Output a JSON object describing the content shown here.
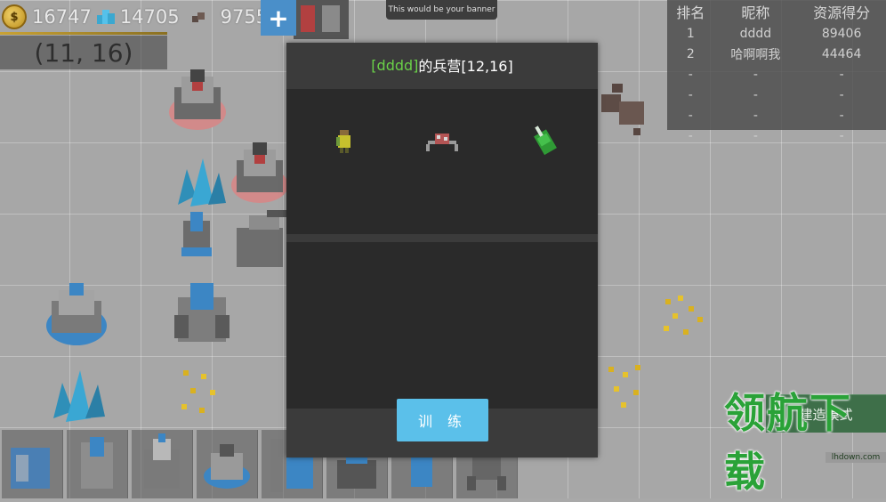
{
  "resources": {
    "gold": "16747",
    "crystal": "14705",
    "ore": "9755",
    "gold_icon_letter": "$"
  },
  "coordinate_display": "(11, 16)",
  "plus_button_label": "+",
  "banner_text": "This would be your banner",
  "ranking": {
    "headers": [
      "排名",
      "昵称",
      "资源得分"
    ],
    "rows": [
      [
        "1",
        "dddd",
        "89406"
      ],
      [
        "2",
        "哈啊啊我",
        "44464"
      ],
      [
        "-",
        "-",
        "-"
      ],
      [
        "-",
        "-",
        "-"
      ],
      [
        "-",
        "-",
        "-"
      ],
      [
        "-",
        "-",
        "-"
      ]
    ]
  },
  "dialog": {
    "title_owner": "[dddd]",
    "title_rest": "的兵营[12,16]",
    "units": [
      "soldier-unit-icon",
      "spider-mech-unit-icon",
      "tank-unit-icon"
    ],
    "train_button": "训 练"
  },
  "build_mode_button": "建造模式",
  "build_slots": [
    "wall-block-icon",
    "cannon-tower-icon",
    "drill-tower-icon",
    "turret-base-icon",
    "pylon-icon",
    "platform-icon",
    "robot-icon",
    "mech-icon"
  ],
  "watermark": {
    "logo": "领航下载",
    "url": "lhdown.com"
  },
  "colors": {
    "accent_blue": "#5bc0ea",
    "owner_green": "#6ad148",
    "build_green": "#3e6f49"
  }
}
